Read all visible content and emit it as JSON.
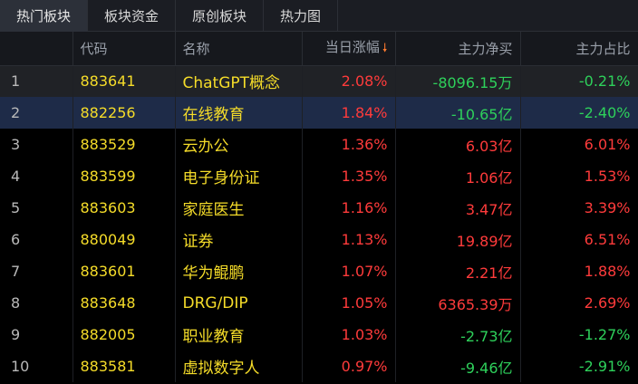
{
  "tabs": [
    {
      "label": "热门板块",
      "active": true
    },
    {
      "label": "板块资金",
      "active": false
    },
    {
      "label": "原创板块",
      "active": false
    },
    {
      "label": "热力图",
      "active": false
    }
  ],
  "columns": {
    "code": "代码",
    "name": "名称",
    "change": "当日涨幅",
    "main_net_buy": "主力净买",
    "main_ratio": "主力占比",
    "sort_icon": "arrow-down-icon"
  },
  "colors": {
    "up": "#ff3b3b",
    "down": "#2ed15b",
    "name": "#f5dc29",
    "sort": "#ff7a2e"
  },
  "rows": [
    {
      "index": "1",
      "code": "883641",
      "name": "ChatGPT概念",
      "change": "2.08%",
      "flow": "-8096.15万",
      "ratio": "-0.21%"
    },
    {
      "index": "2",
      "code": "882256",
      "name": "在线教育",
      "change": "1.84%",
      "flow": "-10.65亿",
      "ratio": "-2.40%"
    },
    {
      "index": "3",
      "code": "883529",
      "name": "云办公",
      "change": "1.36%",
      "flow": "6.03亿",
      "ratio": "6.01%"
    },
    {
      "index": "4",
      "code": "883599",
      "name": "电子身份证",
      "change": "1.35%",
      "flow": "1.06亿",
      "ratio": "1.53%"
    },
    {
      "index": "5",
      "code": "883603",
      "name": "家庭医生",
      "change": "1.16%",
      "flow": "3.47亿",
      "ratio": "3.39%"
    },
    {
      "index": "6",
      "code": "880049",
      "name": "证券",
      "change": "1.13%",
      "flow": "19.89亿",
      "ratio": "6.51%"
    },
    {
      "index": "7",
      "code": "883601",
      "name": "华为鲲鹏",
      "change": "1.07%",
      "flow": "2.21亿",
      "ratio": "1.88%"
    },
    {
      "index": "8",
      "code": "883648",
      "name": "DRG/DIP",
      "change": "1.05%",
      "flow": "6365.39万",
      "ratio": "2.69%"
    },
    {
      "index": "9",
      "code": "882005",
      "name": "职业教育",
      "change": "1.03%",
      "flow": "-2.73亿",
      "ratio": "-1.27%"
    },
    {
      "index": "10",
      "code": "883581",
      "name": "虚拟数字人",
      "change": "0.97%",
      "flow": "-9.46亿",
      "ratio": "-2.91%"
    }
  ]
}
